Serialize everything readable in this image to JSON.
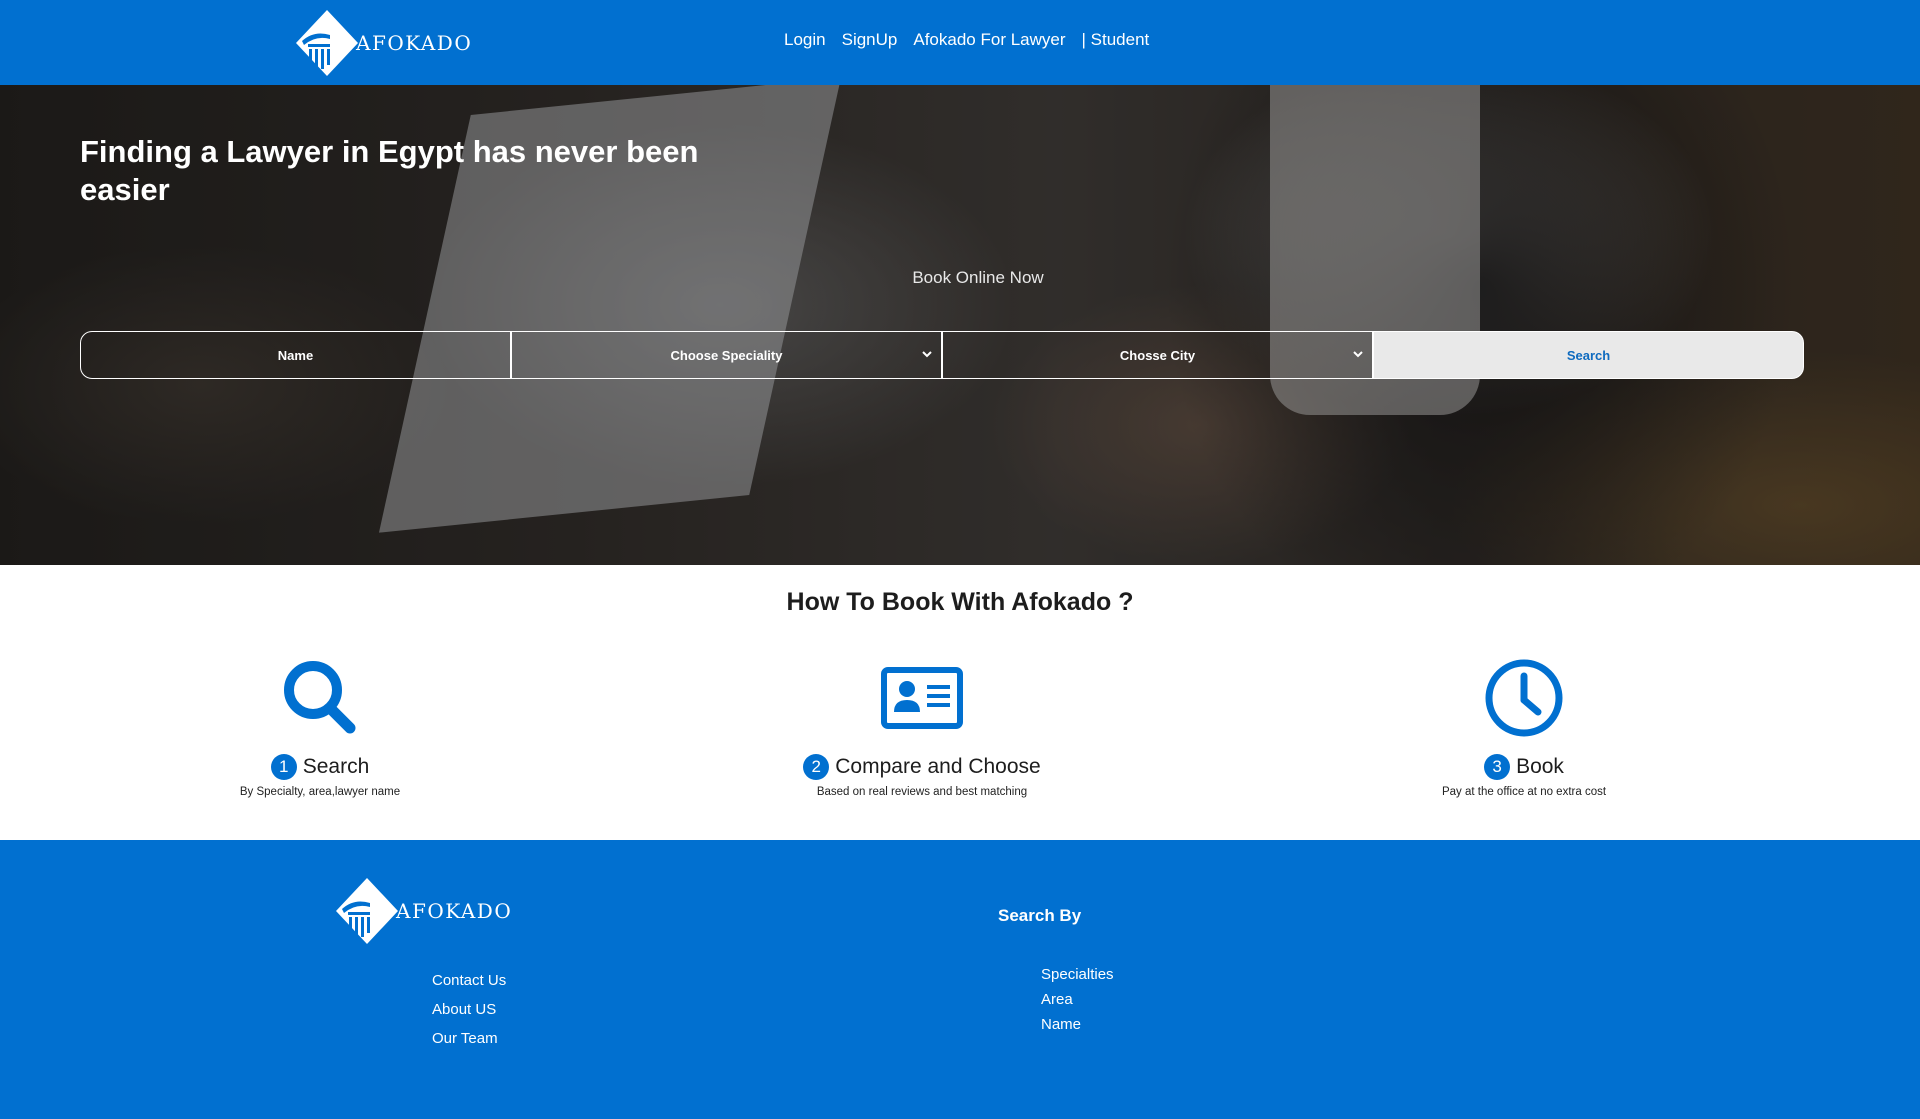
{
  "header": {
    "brand_name": "AFOKADO",
    "nav": [
      "Login",
      "SignUp",
      "Afokado For Lawyer",
      "| Student"
    ]
  },
  "hero": {
    "title": "Finding a Lawyer in Egypt has never been easier",
    "subtitle": "Book Online Now",
    "search": {
      "name_label": "Name",
      "speciality_label": "Choose Speciality",
      "city_label": "Chosse City",
      "button_label": "Search"
    }
  },
  "howto": {
    "title": "How To Book With Afokado ?",
    "steps": [
      {
        "number": "1",
        "title": "Search",
        "desc": "By Specialty, area,lawyer name",
        "icon": "magnifier-icon"
      },
      {
        "number": "2",
        "title": "Compare and Choose",
        "desc": "Based on real reviews and best matching",
        "icon": "id-card-icon"
      },
      {
        "number": "3",
        "title": "Book",
        "desc": "Pay at the office at no extra cost",
        "icon": "clock-icon"
      }
    ]
  },
  "footer": {
    "brand_name": "AFOKADO",
    "links": [
      "Contact Us",
      "About US",
      "Our Team"
    ],
    "search_by_title": "Search By",
    "search_by_links": [
      "Specialties",
      "Area",
      "Name"
    ]
  },
  "colors": {
    "brand_blue": "#0170d0",
    "search_button_bg": "#e9e9e9"
  }
}
